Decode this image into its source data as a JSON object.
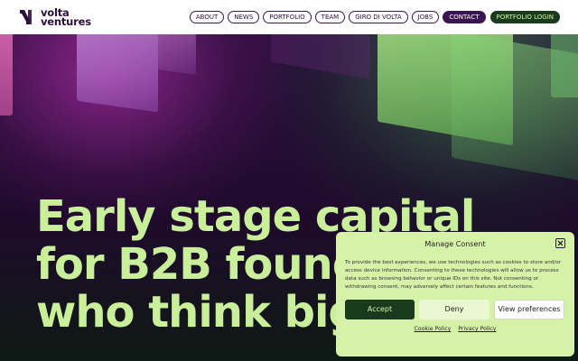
{
  "logo": {
    "line1": "volta",
    "line2": "ventures"
  },
  "nav": {
    "items": [
      "ABOUT",
      "NEWS",
      "PORTFOLIO",
      "TEAM",
      "GIRO DI VOLTA",
      "JOBS"
    ],
    "contact": "CONTACT",
    "login": "PORTFOLIO LOGIN"
  },
  "hero": {
    "headline_lines": [
      "Early stage capital",
      "for B2B founders",
      "who think big."
    ]
  },
  "consent": {
    "title": "Manage Consent",
    "body": "To provide the best experiences, we use technologies such as cookies to store and/or access device information. Consenting to these technologies will allow us to process data such as browsing behavior or unique IDs on this site. Not consenting or withdrawing consent, may adversely affect certain features and functions.",
    "accept": "Accept",
    "deny": "Deny",
    "preferences": "View preferences",
    "cookie_policy": "Cookie Policy",
    "privacy_policy": "Privacy Policy"
  },
  "colors": {
    "brand_purple": "#3b1550",
    "brand_green_dark": "#193a1c",
    "accent_lime": "#c9ef9a",
    "consent_bg": "#d6f2a8"
  }
}
